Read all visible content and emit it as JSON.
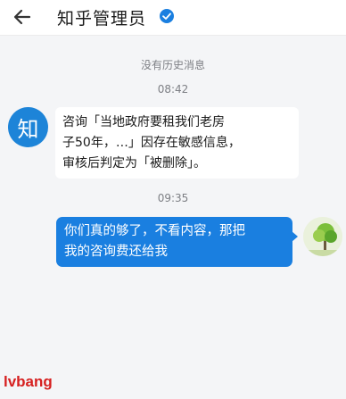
{
  "header": {
    "title": "知乎管理员",
    "back_icon": "arrow-left-icon",
    "verified_icon": "verified-check-icon"
  },
  "system_note": "没有历史消息",
  "timestamps": [
    "08:42",
    "09:35"
  ],
  "messages": {
    "incoming": {
      "avatar_text": "知",
      "lines": [
        "咨询「当地政府要租我们老房",
        "子50年，…」因存在敏感信息，",
        "审核后判定为「被删除」。"
      ]
    },
    "outgoing": {
      "avatar_icon": "tree-avatar",
      "lines": [
        "你们真的够了，不看内容，那把",
        "我的咨询费还给我"
      ]
    }
  },
  "watermark": "lvbang",
  "colors": {
    "brand_blue": "#1a7fe0",
    "avatar_blue": "#1d84d8",
    "background": "#f4f5f7",
    "watermark_red": "#d62020"
  }
}
